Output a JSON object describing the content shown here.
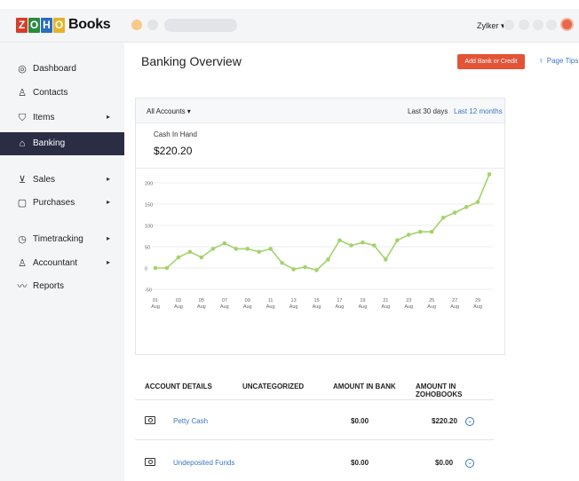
{
  "app": {
    "logo_letters": [
      "Z",
      "O",
      "H",
      "O"
    ],
    "logo_colors": [
      "#d73c2c",
      "#2a8a3f",
      "#2d6cc0",
      "#e8b227"
    ],
    "logo_text": "Books",
    "org_name": "Zylker ▾"
  },
  "sidebar": {
    "items": [
      {
        "label": "Dashboard",
        "icon": "dashboard-icon",
        "glyph": "◎",
        "has_arrow": false,
        "active": false
      },
      {
        "label": "Contacts",
        "icon": "contacts-icon",
        "glyph": "♙",
        "has_arrow": false,
        "active": false
      },
      {
        "label": "Items",
        "icon": "items-icon",
        "glyph": "⛉",
        "has_arrow": true,
        "active": false
      },
      {
        "label": "Banking",
        "icon": "bank-icon",
        "glyph": "⌂",
        "has_arrow": false,
        "active": true
      },
      {
        "label": "Sales",
        "icon": "cart-icon",
        "glyph": "⊻",
        "has_arrow": true,
        "active": false
      },
      {
        "label": "Purchases",
        "icon": "bag-icon",
        "glyph": "▢",
        "has_arrow": true,
        "active": false
      },
      {
        "label": "Timetracking",
        "icon": "stopwatch-icon",
        "glyph": "◷",
        "has_arrow": true,
        "active": false
      },
      {
        "label": "Accountant",
        "icon": "accountant-icon",
        "glyph": "♙",
        "has_arrow": true,
        "active": false
      },
      {
        "label": "Reports",
        "icon": "reports-icon",
        "glyph": "〰",
        "has_arrow": false,
        "active": false
      }
    ],
    "arrow_glyph": "▸"
  },
  "main": {
    "title": "Banking Overview",
    "add_bank_label": "Add Bank or Credit Card",
    "page_tips_label": "Page Tips",
    "page_tips_icon": "lightbulb-icon"
  },
  "overview_card": {
    "account_filter": "All Accounts ▾",
    "range_30": "Last 30 days",
    "range_12": "Last 12 months",
    "cash_label": "Cash In Hand",
    "cash_value": "$220.20"
  },
  "chart_data": {
    "type": "line",
    "title": "",
    "xlabel": "",
    "ylabel": "",
    "ylim": [
      -50,
      200
    ],
    "yticks": [
      -50,
      0,
      50,
      100,
      150,
      200
    ],
    "x": [
      "01",
      "02",
      "03",
      "04",
      "05",
      "06",
      "07",
      "08",
      "09",
      "10",
      "11",
      "12",
      "13",
      "14",
      "15",
      "16",
      "17",
      "18",
      "19",
      "20",
      "21",
      "22",
      "23",
      "24",
      "25",
      "26",
      "27",
      "28",
      "29",
      "30"
    ],
    "x_tick_labels": [
      {
        "day": "01",
        "month": "Aug"
      },
      {
        "day": "03",
        "month": "Aug"
      },
      {
        "day": "05",
        "month": "Aug"
      },
      {
        "day": "07",
        "month": "Aug"
      },
      {
        "day": "09",
        "month": "Aug"
      },
      {
        "day": "11",
        "month": "Aug"
      },
      {
        "day": "13",
        "month": "Aug"
      },
      {
        "day": "15",
        "month": "Aug"
      },
      {
        "day": "17",
        "month": "Aug"
      },
      {
        "day": "19",
        "month": "Aug"
      },
      {
        "day": "21",
        "month": "Aug"
      },
      {
        "day": "23",
        "month": "Aug"
      },
      {
        "day": "25",
        "month": "Aug"
      },
      {
        "day": "27",
        "month": "Aug"
      },
      {
        "day": "29",
        "month": "Aug"
      }
    ],
    "series": [
      {
        "values": [
          0,
          0,
          25,
          38,
          25,
          45,
          58,
          45,
          45,
          38,
          45,
          12,
          -3,
          2,
          -5,
          20,
          65,
          53,
          60,
          53,
          20,
          65,
          78,
          85,
          85,
          118,
          130,
          143,
          155,
          220
        ]
      }
    ],
    "line_color": "#a3d36a",
    "grid": true
  },
  "accounts_table": {
    "headers": [
      "ACCOUNT DETAILS",
      "UNCATEGORIZED",
      "AMOUNT IN BANK",
      "AMOUNT IN ZOHOBOOKS"
    ],
    "rows": [
      {
        "name": "Petty Cash",
        "bank": "$0.00",
        "books": "$220.20",
        "icon": "cash-icon"
      },
      {
        "name": "Undeposited Funds",
        "bank": "$0.00",
        "books": "$0.00",
        "icon": "cash-icon"
      }
    ],
    "row_action_glyph": "⌄"
  }
}
